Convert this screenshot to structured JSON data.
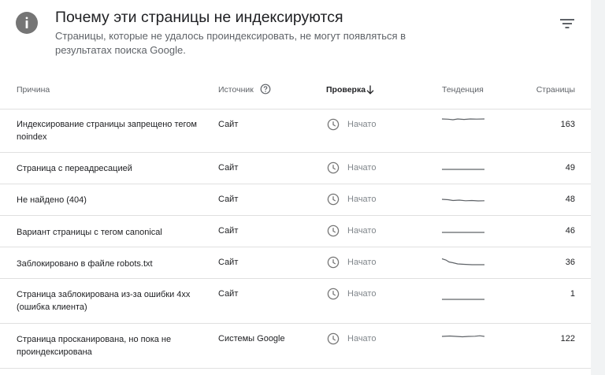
{
  "header": {
    "title": "Почему эти страницы не индексируются",
    "subtitle": "Страницы, которые не удалось проиндексировать, не могут появляться в результатах поиска Google."
  },
  "columns": {
    "reason": "Причина",
    "source": "Источник",
    "validation": "Проверка",
    "trend": "Тенденция",
    "pages": "Страницы"
  },
  "icons": {
    "info": "info-icon",
    "filter": "filter-icon",
    "help": "help-icon",
    "sort": "arrow-down-icon",
    "status": "clock-icon"
  },
  "rows": [
    {
      "reason": "Индексирование страницы запрещено тегом noindex",
      "source": "Сайт",
      "status": "Начато",
      "pages": "163"
    },
    {
      "reason": "Страница с переадресацией",
      "source": "Сайт",
      "status": "Начато",
      "pages": "49"
    },
    {
      "reason": "Не найдено (404)",
      "source": "Сайт",
      "status": "Начато",
      "pages": "48"
    },
    {
      "reason": "Вариант страницы с тегом canonical",
      "source": "Сайт",
      "status": "Начато",
      "pages": "46"
    },
    {
      "reason": "Заблокировано в файле robots.txt",
      "source": "Сайт",
      "status": "Начато",
      "pages": "36"
    },
    {
      "reason": "Страница заблокирована из-за ошибки 4xx (ошибка клиента)",
      "source": "Сайт",
      "status": "Начато",
      "pages": "1"
    },
    {
      "reason": "Страница просканирована, но пока не проиндексирована",
      "source": "Системы Google",
      "status": "Начато",
      "pages": "122"
    }
  ],
  "colors": {
    "icon_gray": "#757575",
    "text_primary": "#202124",
    "text_secondary": "#5f6368",
    "divider": "#e0e0e0",
    "sparkline": "#5f6368"
  }
}
